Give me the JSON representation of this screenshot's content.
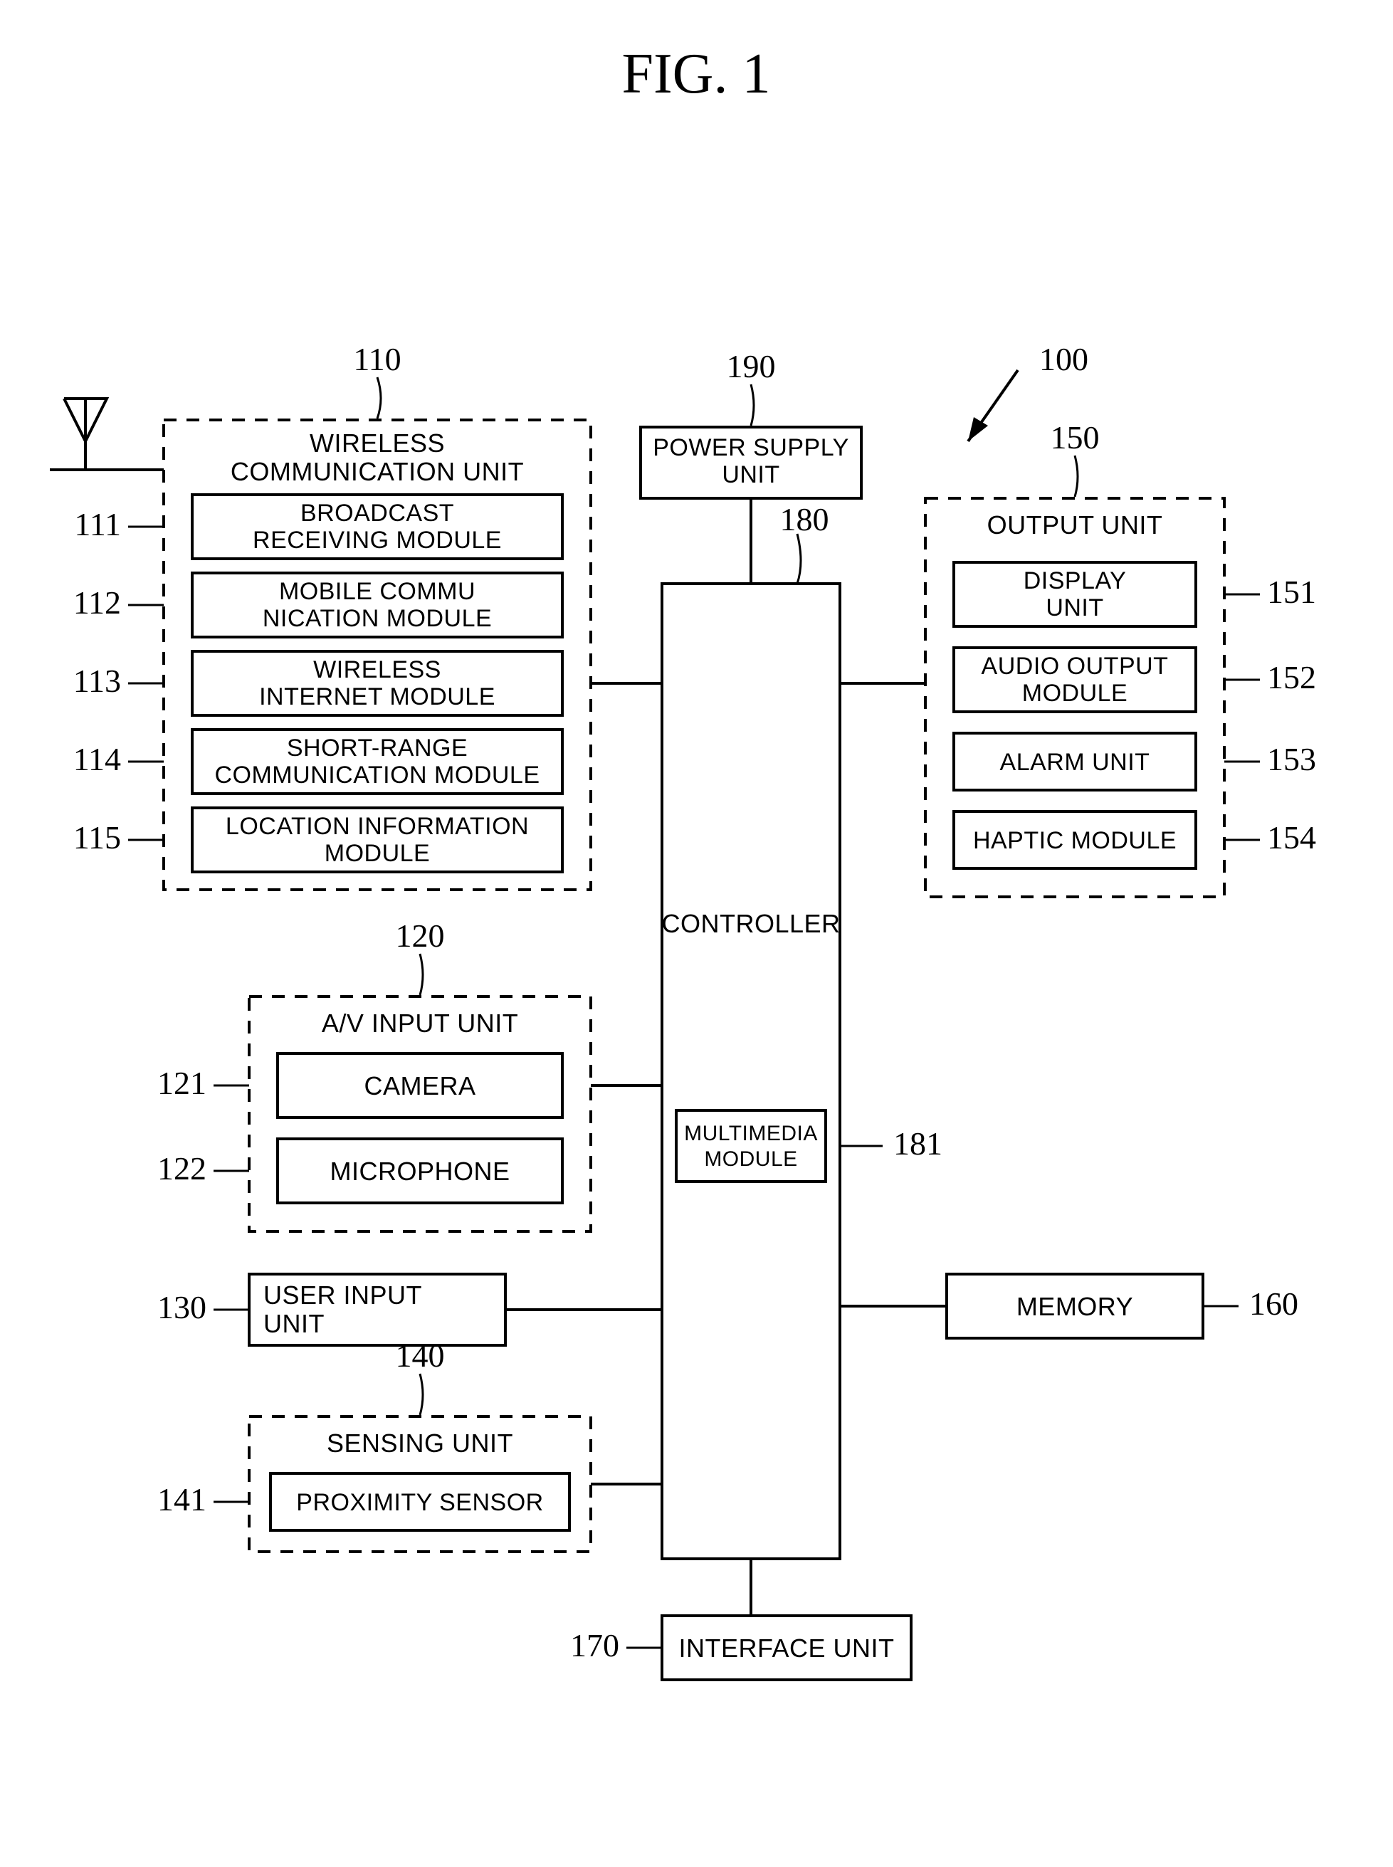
{
  "figure_title": "FIG. 1",
  "refs": {
    "r100": "100",
    "r110": "110",
    "r111": "111",
    "r112": "112",
    "r113": "113",
    "r114": "114",
    "r115": "115",
    "r120": "120",
    "r121": "121",
    "r122": "122",
    "r130": "130",
    "r140": "140",
    "r141": "141",
    "r150": "150",
    "r151": "151",
    "r152": "152",
    "r153": "153",
    "r154": "154",
    "r160": "160",
    "r170": "170",
    "r180": "180",
    "r181": "181",
    "r190": "190"
  },
  "blocks": {
    "wireless_unit": {
      "title_l1": "WIRELESS",
      "title_l2": "COMMUNICATION UNIT"
    },
    "broadcast": {
      "l1": "BROADCAST",
      "l2": "RECEIVING MODULE"
    },
    "mobile_comm": {
      "l1": "MOBILE COMMU",
      "l2": "NICATION MODULE"
    },
    "wifi": {
      "l1": "WIRELESS",
      "l2": "INTERNET MODULE"
    },
    "short_range": {
      "l1": "SHORT-RANGE",
      "l2": "COMMUNICATION MODULE"
    },
    "location": {
      "l1": "LOCATION INFORMATION",
      "l2": "MODULE"
    },
    "av_unit": {
      "title": "A/V INPUT UNIT"
    },
    "camera": {
      "l1": "CAMERA"
    },
    "microphone": {
      "l1": "MICROPHONE"
    },
    "user_input": {
      "l1": "USER INPUT",
      "l2": "UNIT"
    },
    "sensing_unit": {
      "title": "SENSING UNIT"
    },
    "proximity": {
      "l1": "PROXIMITY SENSOR"
    },
    "power": {
      "l1": "POWER SUPPLY",
      "l2": "UNIT"
    },
    "controller": {
      "l1": "CONTROLLER"
    },
    "multimedia": {
      "l1": "MULTIMEDIA",
      "l2": "MODULE"
    },
    "output_unit": {
      "title": "OUTPUT UNIT"
    },
    "display": {
      "l1": "DISPLAY",
      "l2": "UNIT"
    },
    "audio_out": {
      "l1": "AUDIO OUTPUT",
      "l2": "MODULE"
    },
    "alarm": {
      "l1": "ALARM UNIT"
    },
    "haptic": {
      "l1": "HAPTIC MODULE"
    },
    "memory": {
      "l1": "MEMORY"
    },
    "interface": {
      "l1": "INTERFACE UNIT"
    }
  }
}
